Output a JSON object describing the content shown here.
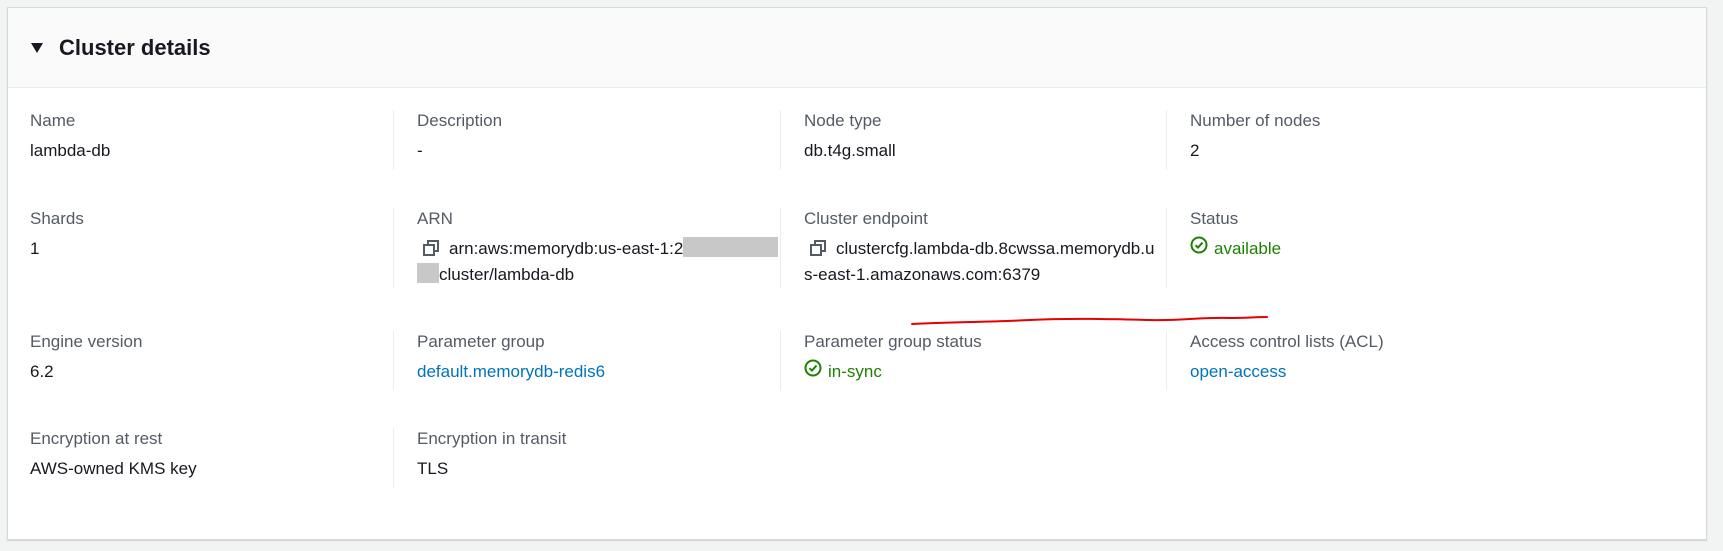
{
  "panel": {
    "title": "Cluster details"
  },
  "fields": {
    "name": {
      "label": "Name",
      "value": "lambda-db"
    },
    "description": {
      "label": "Description",
      "value": "-"
    },
    "node_type": {
      "label": "Node type",
      "value": "db.t4g.small"
    },
    "number_of_nodes": {
      "label": "Number of nodes",
      "value": "2"
    },
    "shards": {
      "label": "Shards",
      "value": "1"
    },
    "arn": {
      "label": "ARN",
      "value_part1": "arn:aws:memorydb:us-east-1:2",
      "value_part2": "cluster/lambda-db"
    },
    "cluster_endpoint": {
      "label": "Cluster endpoint",
      "value_line1": "clustercfg.lambda-db.8cwssa.memorydb.u",
      "value_line2": "s-east-1.amazonaws.com:6379"
    },
    "status": {
      "label": "Status",
      "value": "available"
    },
    "engine_version": {
      "label": "Engine version",
      "value": "6.2"
    },
    "parameter_group": {
      "label": "Parameter group",
      "value": "default.memorydb-redis6"
    },
    "parameter_group_status": {
      "label": "Parameter group status",
      "value": "in-sync"
    },
    "acl": {
      "label": "Access control lists (ACL)",
      "value": "open-access"
    },
    "encryption_at_rest": {
      "label": "Encryption at rest",
      "value": "AWS-owned KMS key"
    },
    "encryption_in_transit": {
      "label": "Encryption in transit",
      "value": "TLS"
    }
  },
  "icons": {
    "caret": "caret-down-icon",
    "copy": "copy-icon",
    "status_ok": "check-circle-icon"
  },
  "colors": {
    "link": "#0073bb",
    "success": "#1d8102",
    "annotation": "#e60000"
  }
}
